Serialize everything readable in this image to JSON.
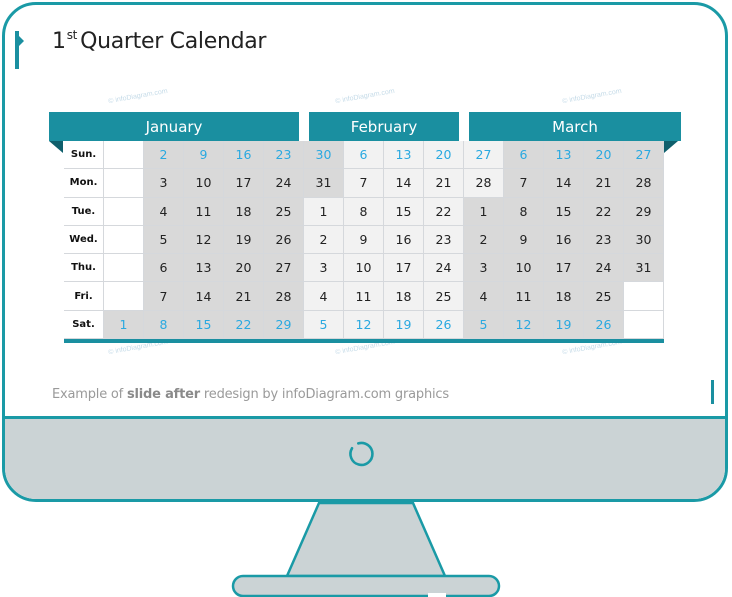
{
  "slide": {
    "title_prefix": "1",
    "title_sup": "st",
    "title_rest": "Quarter Calendar",
    "watermark": "© infoDiagram.com",
    "caption": {
      "part1": "Example of ",
      "bold": "slide after",
      "part2": " redesign by infoDiagram.com graphics"
    }
  },
  "calendar": {
    "months": [
      "January",
      "February",
      "March"
    ],
    "day_labels": [
      "Sun.",
      "Mon.",
      "Tue.",
      "Wed.",
      "Thu.",
      "Fri.",
      "Sat."
    ],
    "rows": [
      [
        "",
        "2",
        "9",
        "16",
        "23",
        "30",
        "6",
        "13",
        "20",
        "27",
        "6",
        "13",
        "20",
        "27"
      ],
      [
        "",
        "3",
        "10",
        "17",
        "24",
        "31",
        "7",
        "14",
        "21",
        "28",
        "7",
        "14",
        "21",
        "28"
      ],
      [
        "",
        "4",
        "11",
        "18",
        "25",
        "1",
        "8",
        "15",
        "22",
        "1",
        "8",
        "15",
        "22",
        "29"
      ],
      [
        "",
        "5",
        "12",
        "19",
        "26",
        "2",
        "9",
        "16",
        "23",
        "2",
        "9",
        "16",
        "23",
        "30"
      ],
      [
        "",
        "6",
        "13",
        "20",
        "27",
        "3",
        "10",
        "17",
        "24",
        "3",
        "10",
        "17",
        "24",
        "31"
      ],
      [
        "",
        "7",
        "14",
        "21",
        "28",
        "4",
        "11",
        "18",
        "25",
        "4",
        "11",
        "18",
        "25",
        ""
      ],
      [
        "1",
        "8",
        "15",
        "22",
        "29",
        "5",
        "12",
        "19",
        "26",
        "5",
        "12",
        "19",
        "26",
        ""
      ]
    ],
    "shading": [
      [
        "w",
        "g",
        "g",
        "g",
        "g",
        "g",
        "l",
        "l",
        "l",
        "l",
        "g",
        "g",
        "g",
        "g"
      ],
      [
        "w",
        "g",
        "g",
        "g",
        "g",
        "g",
        "l",
        "l",
        "l",
        "l",
        "g",
        "g",
        "g",
        "g"
      ],
      [
        "w",
        "g",
        "g",
        "g",
        "g",
        "l",
        "l",
        "l",
        "l",
        "g",
        "g",
        "g",
        "g",
        "g"
      ],
      [
        "w",
        "g",
        "g",
        "g",
        "g",
        "l",
        "l",
        "l",
        "l",
        "g",
        "g",
        "g",
        "g",
        "g"
      ],
      [
        "w",
        "g",
        "g",
        "g",
        "g",
        "l",
        "l",
        "l",
        "l",
        "g",
        "g",
        "g",
        "g",
        "g"
      ],
      [
        "w",
        "g",
        "g",
        "g",
        "g",
        "l",
        "l",
        "l",
        "l",
        "g",
        "g",
        "g",
        "g",
        "w"
      ],
      [
        "g",
        "g",
        "g",
        "g",
        "g",
        "l",
        "l",
        "l",
        "l",
        "g",
        "g",
        "g",
        "g",
        "w"
      ]
    ],
    "weekend_rows": [
      0,
      6
    ]
  },
  "colors": {
    "accent": "#1a8fa0",
    "frame": "#1a9aa6",
    "bezel": "#cbd3d5",
    "weekend_text": "#2aa9e0",
    "cell_gray": "#d9d9d9",
    "cell_light": "#f2f2f2"
  }
}
